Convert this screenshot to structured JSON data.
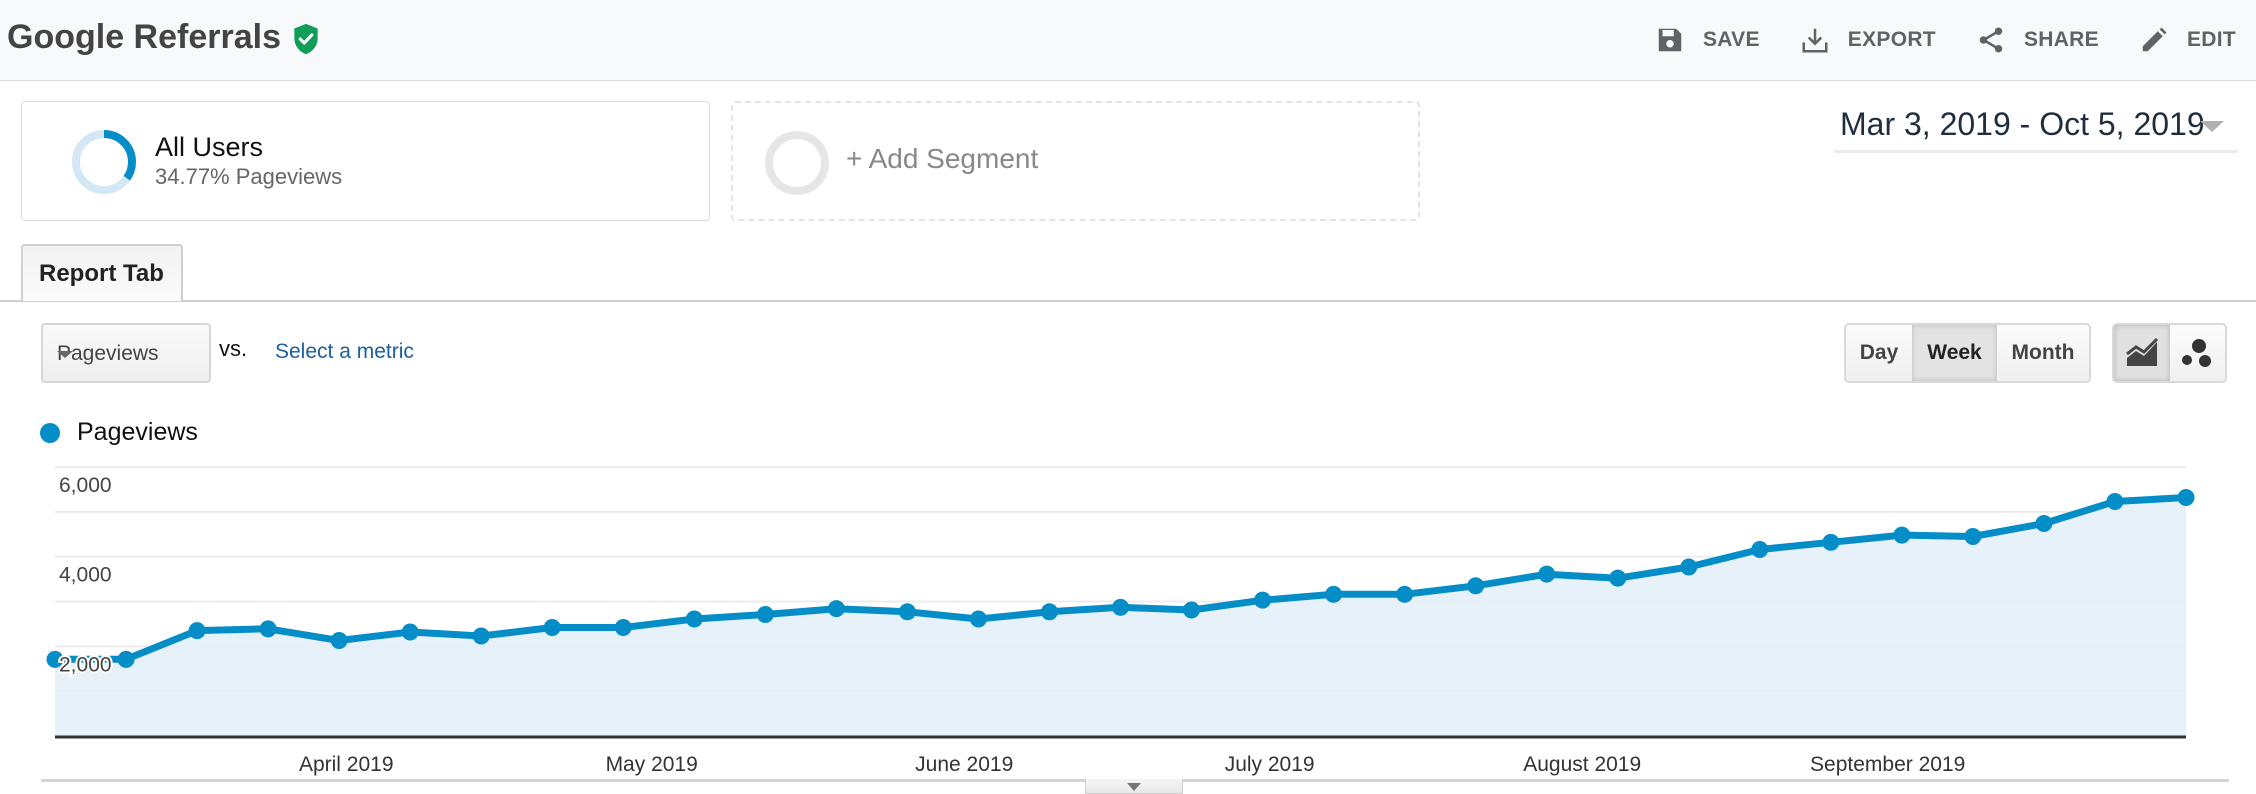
{
  "header": {
    "title": "Google Referrals",
    "verified_icon": "shield-check-icon",
    "verified_color": "#0f9d58",
    "actions": [
      {
        "label": "SAVE",
        "icon": "save-icon"
      },
      {
        "label": "EXPORT",
        "icon": "download-icon"
      },
      {
        "label": "SHARE",
        "icon": "share-icon"
      },
      {
        "label": "EDIT",
        "icon": "pencil-icon"
      }
    ]
  },
  "segments": [
    {
      "name": "All Users",
      "subtitle": "34.77% Pageviews",
      "share_fraction": 0.3477,
      "color": "#058dc7"
    },
    {
      "add_label": "+ Add Segment"
    }
  ],
  "date_range": "Mar 3, 2019 - Oct 5, 2019",
  "tabs": [
    {
      "label": "Report Tab",
      "active": true
    }
  ],
  "metric_selector": {
    "selected": "Pageviews",
    "vs_label": "vs.",
    "compare_link": "Select a metric"
  },
  "period_buttons": [
    {
      "label": "Day",
      "active": false
    },
    {
      "label": "Week",
      "active": true
    },
    {
      "label": "Month",
      "active": false
    }
  ],
  "chart_type_buttons": [
    {
      "icon": "line-chart-icon",
      "active": true
    },
    {
      "icon": "motion-chart-icon",
      "active": false
    }
  ],
  "chart_data": {
    "type": "area",
    "title": "",
    "legend": [
      {
        "name": "Pageviews",
        "color": "#058dc7"
      }
    ],
    "legend_placement": "top-left",
    "xlabel": "",
    "ylabel": "",
    "ylim": [
      0,
      6000
    ],
    "y_ticks": [
      {
        "value": 6000,
        "label": "6,000"
      },
      {
        "value": 4000,
        "label": "4,000"
      },
      {
        "value": 2000,
        "label": "2,000"
      }
    ],
    "gridlines": [
      1000,
      2000,
      3000,
      4000,
      5000,
      6000
    ],
    "grid": true,
    "x_tick_labels": [
      {
        "label": "April 2019",
        "index": 4.1
      },
      {
        "label": "May 2019",
        "index": 8.4
      },
      {
        "label": "June 2019",
        "index": 12.8
      },
      {
        "label": "July 2019",
        "index": 17.1
      },
      {
        "label": "August 2019",
        "index": 21.5
      },
      {
        "label": "September 2019",
        "index": 25.8
      }
    ],
    "series": [
      {
        "name": "Pageviews",
        "color": "#058dc7",
        "fill": "#e3f0f8",
        "values": [
          1710,
          1710,
          2350,
          2390,
          2130,
          2320,
          2230,
          2420,
          2420,
          2610,
          2710,
          2840,
          2770,
          2610,
          2770,
          2870,
          2810,
          3030,
          3160,
          3160,
          3350,
          3610,
          3520,
          3770,
          4160,
          4320,
          4480,
          4450,
          4740,
          5230,
          5320
        ]
      }
    ]
  }
}
